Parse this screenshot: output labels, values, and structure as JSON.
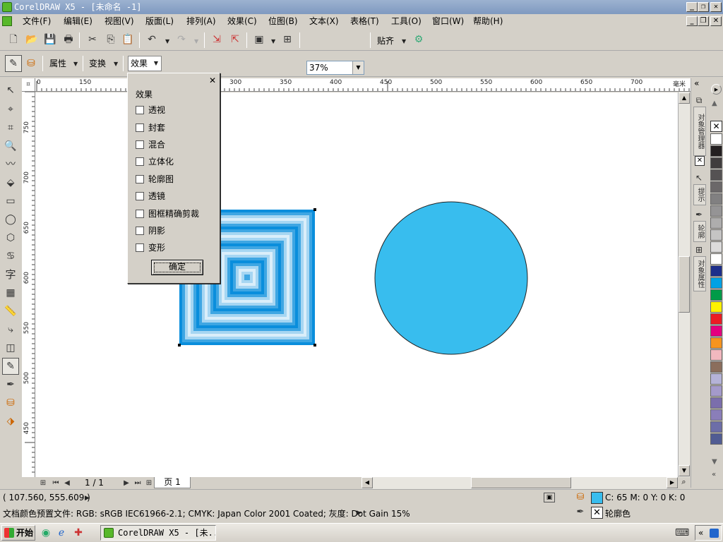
{
  "window": {
    "title": "CorelDRAW X5 - [未命名 -1]",
    "min_glyph": "_",
    "restore_glyph": "❐",
    "close_glyph": "✕"
  },
  "menu": [
    "文件(F)",
    "编辑(E)",
    "视图(V)",
    "版面(L)",
    "排列(A)",
    "效果(C)",
    "位图(B)",
    "文本(X)",
    "表格(T)",
    "工具(O)",
    "窗口(W)",
    "帮助(H)"
  ],
  "toolbar": {
    "zoom": "37%",
    "snap_label": "贴齐"
  },
  "property_bar": {
    "attr_label": "属性",
    "transform_label": "变换",
    "effects_label": "效果"
  },
  "ruler": {
    "h_ticks": [
      "0",
      "150",
      "300",
      "350",
      "400",
      "450",
      "500",
      "550",
      "600",
      "650",
      "700"
    ],
    "unit": "毫米",
    "v_ticks": [
      "750",
      "700",
      "650",
      "600",
      "550",
      "500",
      "450"
    ]
  },
  "effects_dialog": {
    "title": "效果",
    "items": [
      "透视",
      "封套",
      "混合",
      "立体化",
      "轮廓图",
      "透镜",
      "图框精确剪裁",
      "阴影",
      "变形"
    ],
    "ok": "确定",
    "close_glyph": "✕"
  },
  "docker_tabs": [
    "对象管理器",
    "提示",
    "轮廓",
    "对象属性"
  ],
  "palette": [
    "#ffffff",
    "#231f20",
    "#403d3e",
    "#555253",
    "#6b6869",
    "#818081",
    "#959495",
    "#aeadad",
    "#c5c4c4",
    "#dcdbdb",
    "#ffffff",
    "#1d2e8b",
    "#00a1e4",
    "#009b48",
    "#fff100",
    "#ec1c24",
    "#e4007f",
    "#f7941d",
    "#f2b8bf",
    "#8b6e5c",
    "#b5b3d8",
    "#a49acb",
    "#7b6eac",
    "#8a7eb9",
    "#6d6ea8",
    "#515c93"
  ],
  "page_nav": {
    "counter": "1 / 1",
    "page_tab": "页 1"
  },
  "status": {
    "coords": "( 107.560, 555.609 )",
    "profile": "文档颜色预置文件: RGB: sRGB IEC61966-2.1; CMYK: Japan Color 2001 Coated; 灰度: Dot Gain 15%",
    "fill_text": "C: 65 M: 0 Y: 0 K: 0",
    "outline_text": "轮廓色",
    "fill_color": "#38bdee"
  },
  "taskbar": {
    "start": "开始",
    "task": "CorelDRAW X5 - [未..."
  },
  "colors": {
    "circle_fill": "#38bdee",
    "square_outer": "#0a8edc",
    "square_light": "#ffffff"
  }
}
